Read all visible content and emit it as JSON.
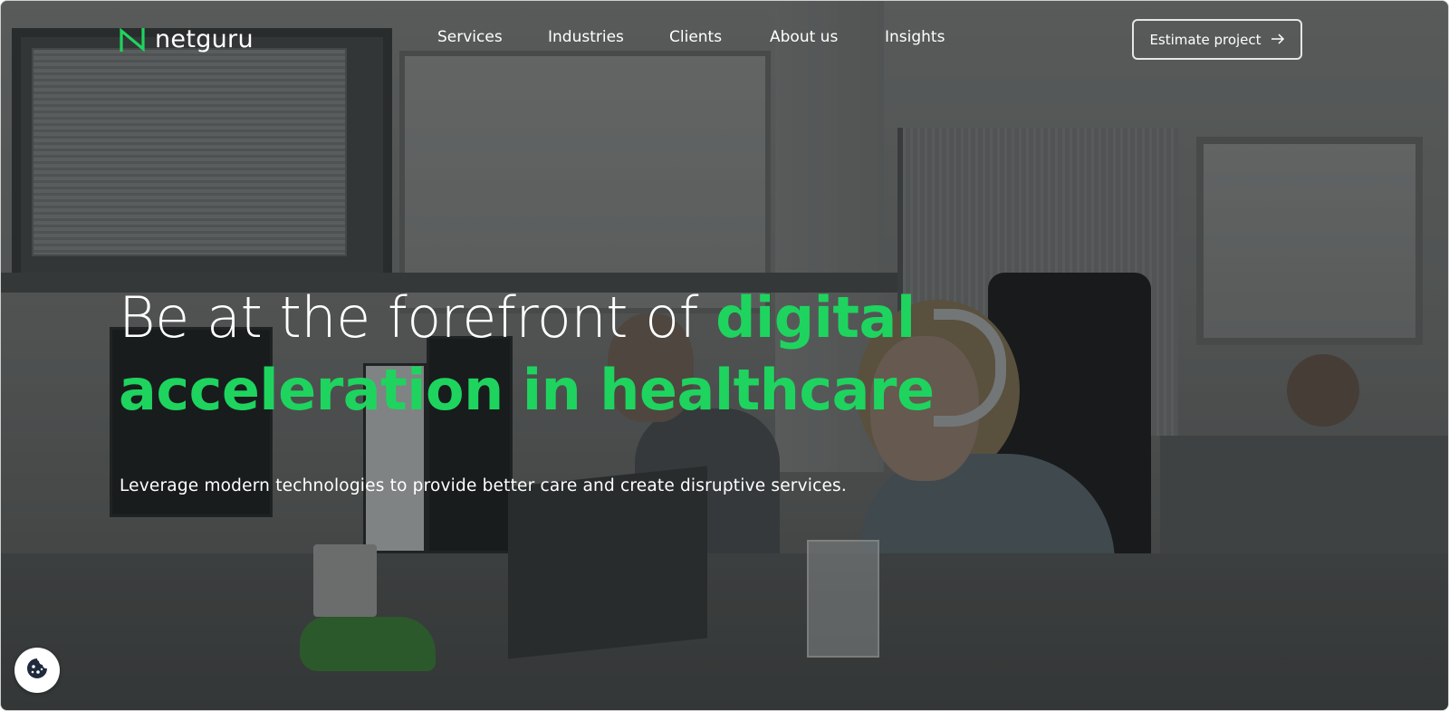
{
  "brand": {
    "name": "netguru",
    "logo_icon": "netguru-n-logo-icon",
    "accent_color": "#1ed45f"
  },
  "nav": {
    "items": [
      {
        "label": "Services"
      },
      {
        "label": "Industries"
      },
      {
        "label": "Clients"
      },
      {
        "label": "About us"
      },
      {
        "label": "Insights"
      }
    ],
    "cta": {
      "label": "Estimate project",
      "icon": "arrow-right-icon"
    }
  },
  "hero": {
    "headline_plain": "Be at the forefront of ",
    "headline_accent": "digital acceleration in healthcare",
    "subheadline": "Leverage modern technologies to provide better care and create disruptive services."
  },
  "cookie": {
    "icon": "cookie-icon"
  }
}
